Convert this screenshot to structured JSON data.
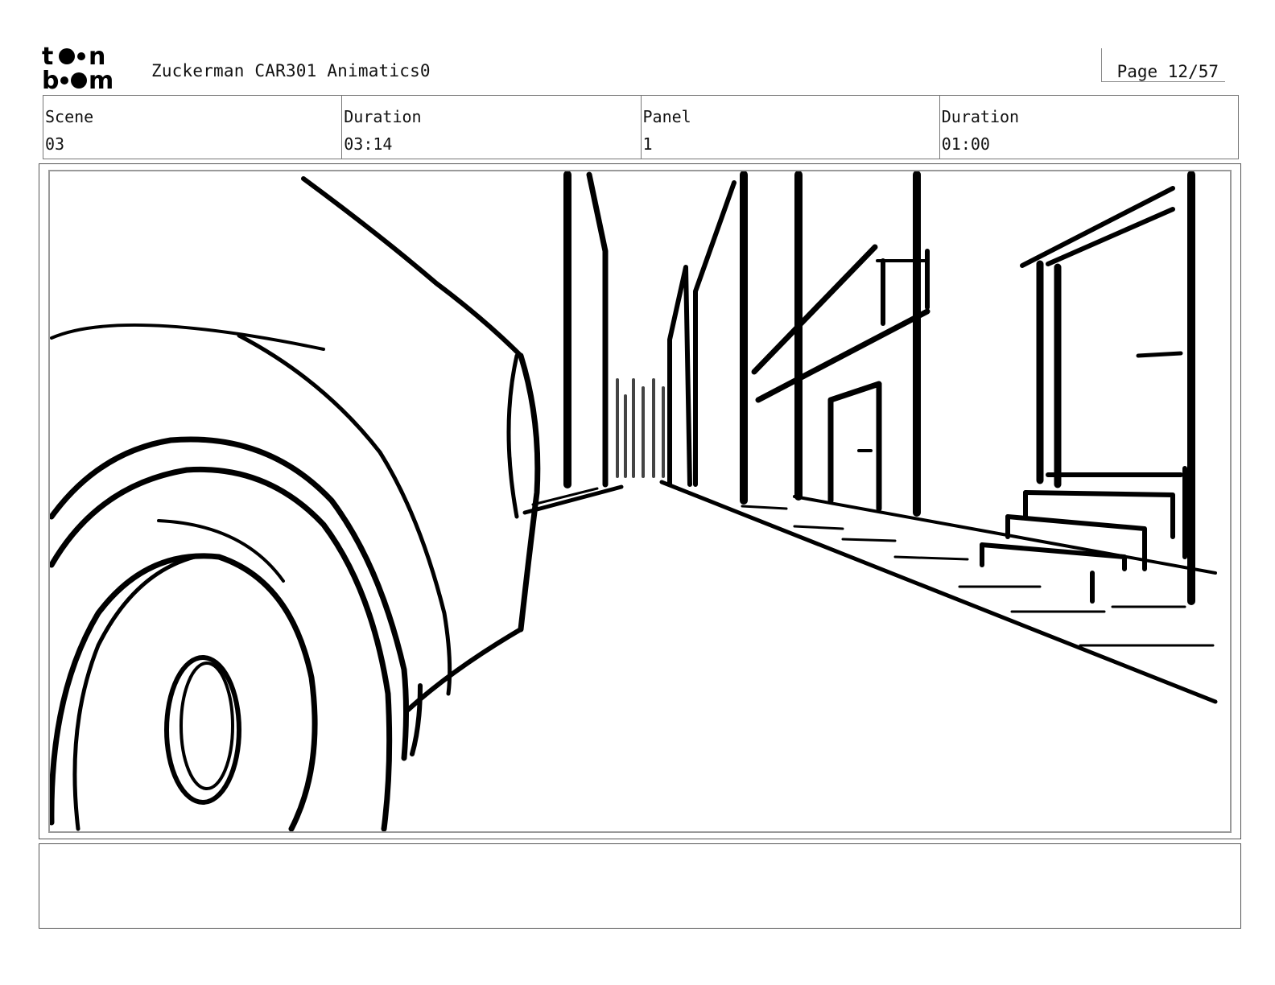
{
  "header": {
    "logo_text": "toonboom",
    "title": "Zuckerman CAR301 Animatics0",
    "page_label": "Page 12/57"
  },
  "meta": {
    "scene_label": "Scene",
    "scene_value": "03",
    "scene_duration_label": "Duration",
    "scene_duration_value": "03:14",
    "panel_label": "Panel",
    "panel_value": "1",
    "panel_duration_label": "Duration",
    "panel_duration_value": "01:00"
  },
  "panel_image_icon": "storyboard-sketch-car-wheel-street",
  "colors": {
    "ink": "#000000",
    "frame": "#9a9a9a",
    "paper": "#ffffff"
  }
}
